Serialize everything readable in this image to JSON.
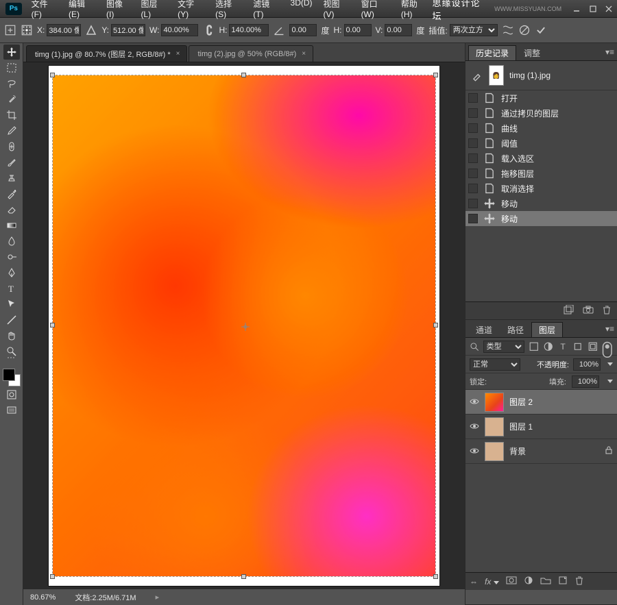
{
  "titlebar": {
    "logo": "Ps",
    "watermark": "思缘设计论坛",
    "watermark2": "WWW.MISSYUAN.COM"
  },
  "menu": [
    "文件(F)",
    "编辑(E)",
    "图像(I)",
    "图层(L)",
    "文字(Y)",
    "选择(S)",
    "滤镜(T)",
    "3D(D)",
    "视图(V)",
    "窗口(W)",
    "帮助(H)"
  ],
  "options": {
    "x_label": "X:",
    "x_value": "384.00 像",
    "y_label": "Y:",
    "y_value": "512.00 像",
    "w_label": "W:",
    "w_value": "40.00%",
    "h_label": "H:",
    "h_value": "140.00%",
    "angle_value": "0.00",
    "angle_unit": "度",
    "hskew_label": "H:",
    "hskew_value": "0.00",
    "vskew_label": "V:",
    "vskew_value": "0.00",
    "skew_unit": "度",
    "interp_label": "插值:",
    "interp_value": "两次立方"
  },
  "tabs": [
    {
      "label": "timg (1).jpg @ 80.7% (图层 2, RGB/8#) *",
      "active": true
    },
    {
      "label": "timg (2).jpg @ 50% (RGB/8#)",
      "active": false
    }
  ],
  "status": {
    "zoom": "80.67%",
    "doc": "文档:2.25M/6.71M"
  },
  "history": {
    "tab1": "历史记录",
    "tab2": "调整",
    "doc_name": "timg (1).jpg",
    "items": [
      {
        "icon": "document",
        "label": "打开"
      },
      {
        "icon": "document",
        "label": "通过拷贝的图层"
      },
      {
        "icon": "document",
        "label": "曲线"
      },
      {
        "icon": "document",
        "label": "阈值"
      },
      {
        "icon": "document",
        "label": "载入选区"
      },
      {
        "icon": "document",
        "label": "拖移图层"
      },
      {
        "icon": "document",
        "label": "取消选择"
      },
      {
        "icon": "move",
        "label": "移动"
      },
      {
        "icon": "move",
        "label": "移动",
        "selected": true
      }
    ]
  },
  "channels": {
    "tab1": "通道",
    "tab2": "路径",
    "tab3": "图层"
  },
  "layers": {
    "filter_label": "类型",
    "blend_mode": "正常",
    "opacity_label": "不透明度:",
    "opacity_value": "100%",
    "lock_label": "锁定:",
    "fill_label": "填充:",
    "fill_value": "100%",
    "items": [
      {
        "name": "图层 2",
        "thumb": "wc",
        "selected": true
      },
      {
        "name": "图层 1",
        "thumb": "face"
      },
      {
        "name": "背景",
        "thumb": "face",
        "locked": true
      }
    ]
  }
}
